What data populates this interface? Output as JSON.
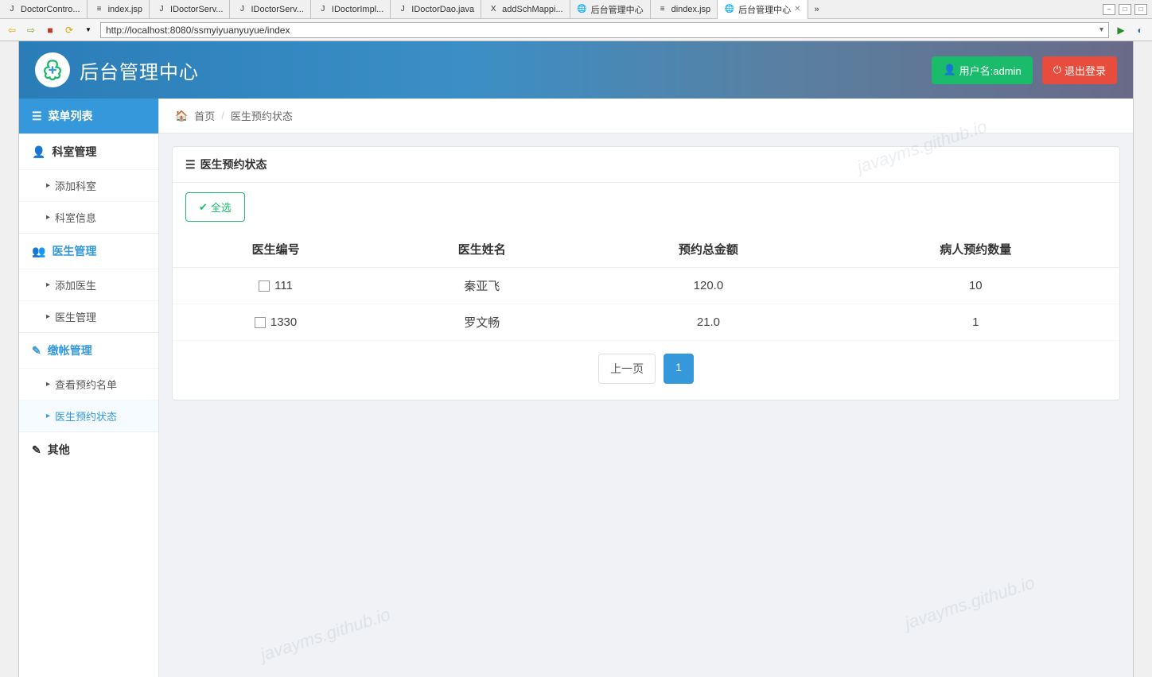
{
  "ide": {
    "tabs": [
      {
        "label": "DoctorContro...",
        "icon": "J",
        "active": false
      },
      {
        "label": "index.jsp",
        "icon": "≡",
        "active": false
      },
      {
        "label": "IDoctorServ...",
        "icon": "J",
        "active": false
      },
      {
        "label": "IDoctorServ...",
        "icon": "J",
        "active": false
      },
      {
        "label": "IDoctorImpl...",
        "icon": "J",
        "active": false
      },
      {
        "label": "IDoctorDao.java",
        "icon": "J",
        "active": false
      },
      {
        "label": "addSchMappi...",
        "icon": "X",
        "active": false
      },
      {
        "label": "后台管理中心",
        "icon": "🌐",
        "active": false
      },
      {
        "label": "dindex.jsp",
        "icon": "≡",
        "active": false
      },
      {
        "label": "后台管理中心",
        "icon": "🌐",
        "active": true,
        "close": "✕"
      }
    ],
    "more": "»",
    "url": "http://localhost:8080/ssmyiyuanyuyue/index"
  },
  "header": {
    "title": "后台管理中心",
    "user_label": "用户名:admin",
    "logout_label": "退出登录"
  },
  "sidebar": {
    "menu_title": "菜单列表",
    "sections": [
      {
        "title": "科室管理",
        "blue": false,
        "items": [
          {
            "label": "添加科室"
          },
          {
            "label": "科室信息"
          }
        ]
      },
      {
        "title": "医生管理",
        "blue": true,
        "items": [
          {
            "label": "添加医生"
          },
          {
            "label": "医生管理"
          }
        ]
      },
      {
        "title": "缴帐管理",
        "blue": true,
        "items": [
          {
            "label": "查看预约名单"
          },
          {
            "label": "医生预约状态",
            "active": true
          }
        ]
      },
      {
        "title": "其他",
        "blue": false,
        "items": []
      }
    ]
  },
  "breadcrumb": {
    "home": "首页",
    "current": "医生预约状态"
  },
  "panel": {
    "title": "医生预约状态",
    "select_all": "全选",
    "columns": [
      "医生编号",
      "医生姓名",
      "预约总金额",
      "病人预约数量"
    ],
    "rows": [
      {
        "id": "111",
        "name": "秦亚飞",
        "amount": "120.0",
        "count": "10"
      },
      {
        "id": "1330",
        "name": "罗文畅",
        "amount": "21.0",
        "count": "1"
      }
    ],
    "prev": "上一页",
    "page": "1"
  },
  "watermark": "javayms.github.io"
}
